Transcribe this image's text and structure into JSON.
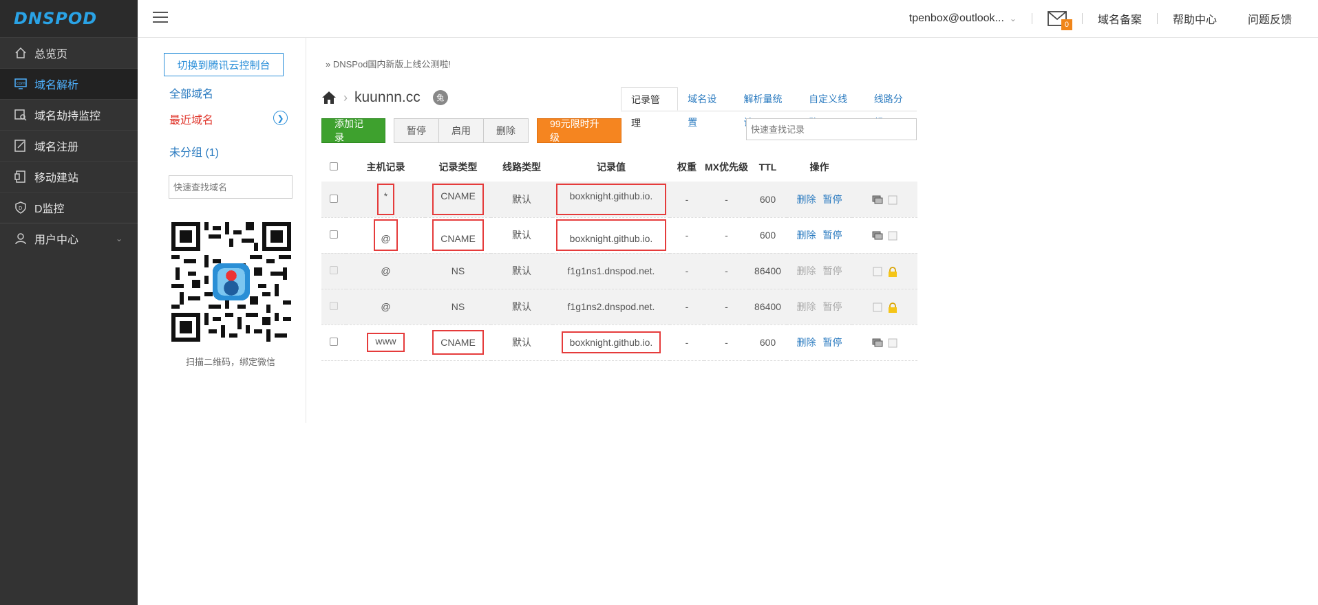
{
  "brand": {
    "logo_text": "DNSPOD"
  },
  "sidebar": {
    "items": [
      {
        "label": "总览页",
        "icon": "home-icon"
      },
      {
        "label": "域名解析",
        "icon": "dns-icon",
        "active": true
      },
      {
        "label": "域名劫持监控",
        "icon": "monitor-icon"
      },
      {
        "label": "域名注册",
        "icon": "register-icon"
      },
      {
        "label": "移动建站",
        "icon": "mobile-site-icon"
      },
      {
        "label": "D监控",
        "icon": "shield-icon"
      },
      {
        "label": "用户中心",
        "icon": "user-icon"
      }
    ]
  },
  "topbar": {
    "user": "tpenbox@outlook...",
    "mail_count": "0",
    "links": [
      "域名备案",
      "帮助中心",
      "问题反馈"
    ]
  },
  "domain_panel": {
    "switch_label": "切换到腾讯云控制台",
    "all_domains": "全部域名",
    "recent_domains": "最近域名",
    "ungrouped": "未分组 (1)",
    "search_placeholder": "快速查找域名",
    "qr_caption": "扫描二维码，绑定微信"
  },
  "main": {
    "notice": "» DNSPod国内新版上线公测啦!",
    "domain": "kuunnn.cc",
    "domain_badge": "兔",
    "tabs": [
      "记录管理",
      "域名设置",
      "解析量统计",
      "自定义线路",
      "线路分组"
    ],
    "toolbar": {
      "add": "添加记录",
      "pause": "暂停",
      "enable": "启用",
      "delete": "删除",
      "upgrade": "99元限时升级"
    },
    "record_search_placeholder": "快速查找记录",
    "table": {
      "headers": [
        "主机记录",
        "记录类型",
        "线路类型",
        "记录值",
        "权重",
        "MX优先级",
        "TTL",
        "操作"
      ],
      "rows": [
        {
          "host": "*",
          "type": "CNAME",
          "line": "默认",
          "value": "boxknight.github.io.",
          "weight": "-",
          "mx": "-",
          "ttl": "600",
          "delete": "删除",
          "pause": "暂停"
        },
        {
          "host": "@",
          "type": "CNAME",
          "line": "默认",
          "value": "boxknight.github.io.",
          "weight": "-",
          "mx": "-",
          "ttl": "600",
          "delete": "删除",
          "pause": "暂停"
        },
        {
          "host": "@",
          "type": "NS",
          "line": "默认",
          "value": "f1g1ns1.dnspod.net.",
          "weight": "-",
          "mx": "-",
          "ttl": "86400",
          "delete": "删除",
          "pause": "暂停"
        },
        {
          "host": "@",
          "type": "NS",
          "line": "默认",
          "value": "f1g1ns2.dnspod.net.",
          "weight": "-",
          "mx": "-",
          "ttl": "86400",
          "delete": "删除",
          "pause": "暂停"
        },
        {
          "host": "www",
          "type": "CNAME",
          "line": "默认",
          "value": "boxknight.github.io.",
          "weight": "-",
          "mx": "-",
          "ttl": "600",
          "delete": "删除",
          "pause": "暂停"
        }
      ]
    }
  },
  "colors": {
    "sidebar_bg": "#333333",
    "accent_blue": "#2b7bc0",
    "add_green": "#3ea12e",
    "upgrade_orange": "#f58520",
    "highlight_red": "#e53b3b"
  }
}
